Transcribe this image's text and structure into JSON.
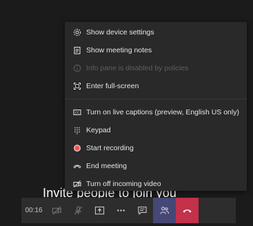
{
  "menu": {
    "items": [
      {
        "label": "Show device settings",
        "icon": "gear-icon",
        "enabled": true
      },
      {
        "label": "Show meeting notes",
        "icon": "notes-icon",
        "enabled": true
      },
      {
        "label": "Info pane is disabled by policies",
        "icon": "info-icon",
        "enabled": false
      },
      {
        "label": "Enter full-screen",
        "icon": "fullscreen-icon",
        "enabled": true
      },
      {
        "label": "Turn on live captions (preview, English US only)",
        "icon": "captions-icon",
        "enabled": true
      },
      {
        "label": "Keypad",
        "icon": "keypad-icon",
        "enabled": true
      },
      {
        "label": "Start recording",
        "icon": "record-icon",
        "enabled": true
      },
      {
        "label": "End meeting",
        "icon": "end-meeting-icon",
        "enabled": true
      },
      {
        "label": "Turn off incoming video",
        "icon": "video-off-icon",
        "enabled": true
      }
    ]
  },
  "background": {
    "invite_text": "Invite people to join you"
  },
  "toolbar": {
    "timer": "00:16",
    "buttons": [
      "camera-off-icon",
      "mic-off-icon",
      "share-screen-icon",
      "more-icon",
      "chat-icon",
      "participants-icon",
      "hang-up-icon"
    ]
  },
  "colors": {
    "menu_bg": "#292929",
    "toolbar_bg": "#2d2d2d",
    "participants_bg": "#464775",
    "hangup_bg": "#c4314b",
    "record_dot": "#e05a5a",
    "disabled_text": "#5f5f5f"
  }
}
